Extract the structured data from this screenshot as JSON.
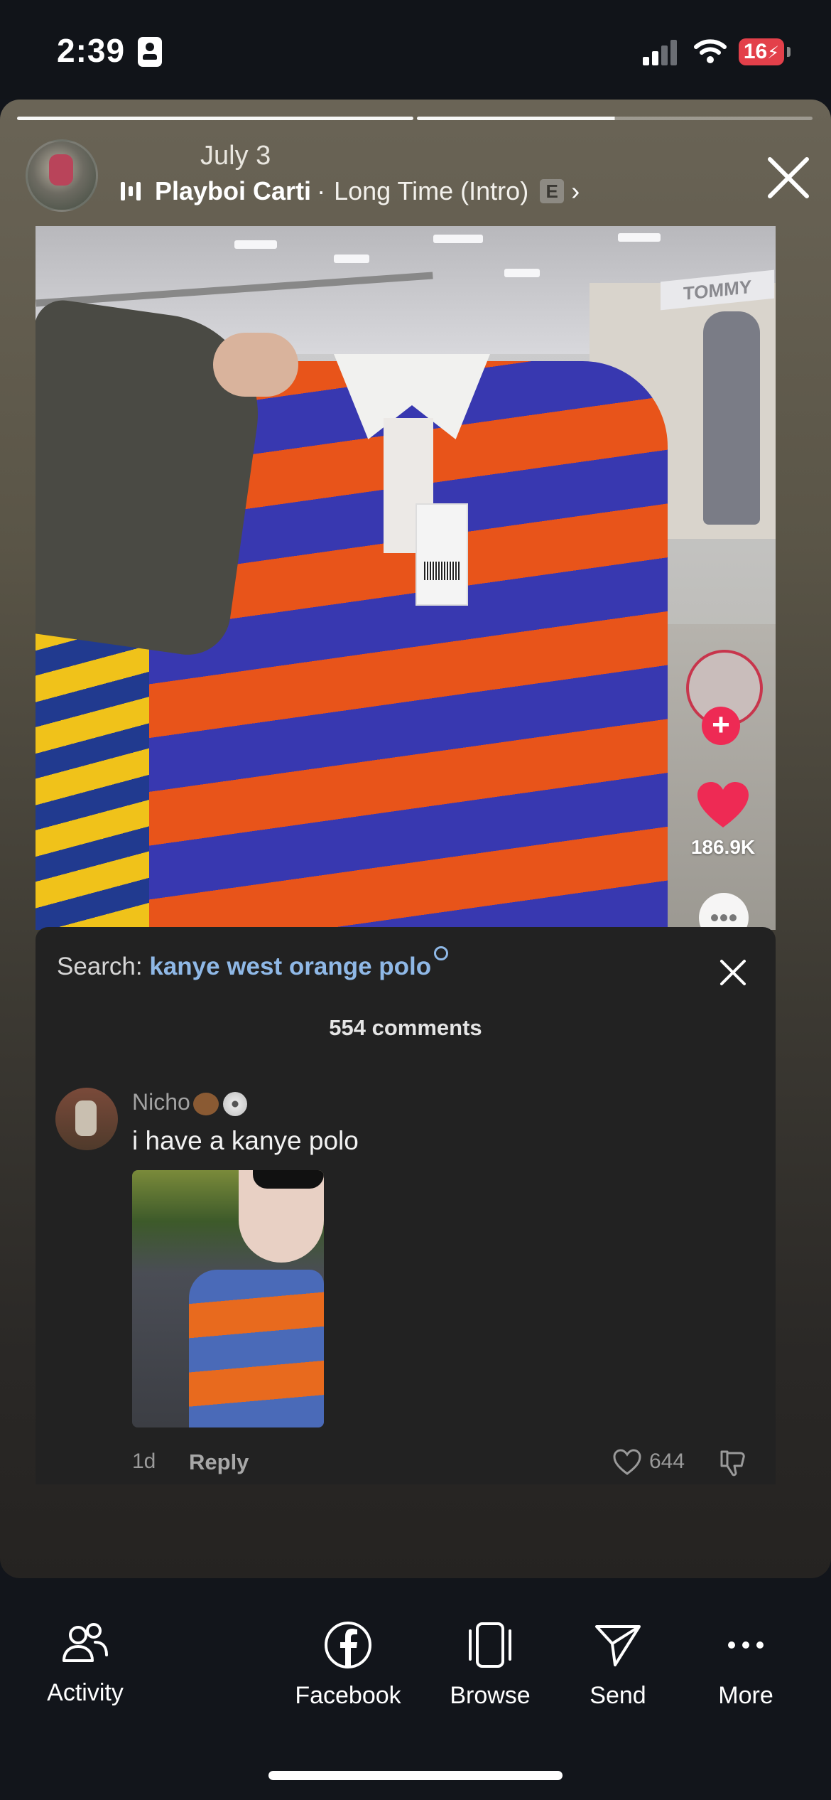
{
  "status_bar": {
    "time": "2:39",
    "battery": "16"
  },
  "story": {
    "date": "July 3",
    "music": {
      "artist": "Playboi Carti",
      "separator": "·",
      "song": "Long Time (Intro)",
      "explicit_badge": "E"
    },
    "progress": {
      "segments": 2,
      "current_segment": 1,
      "current_fill": 0.5
    },
    "like_count": "186.9K"
  },
  "comments_panel": {
    "search_label": "Search:",
    "search_query": "kanye west orange polo",
    "comment_count": "554 comments",
    "comments": [
      {
        "username": "Nicho",
        "text": "i have a kanye polo",
        "time": "1d",
        "reply_label": "Reply",
        "likes": "644"
      }
    ]
  },
  "bottom_nav": [
    {
      "label": "Activity",
      "icon": "people-icon"
    },
    {
      "label": "Facebook",
      "icon": "facebook-icon"
    },
    {
      "label": "Browse",
      "icon": "browse-icon"
    },
    {
      "label": "Send",
      "icon": "send-icon"
    },
    {
      "label": "More",
      "icon": "more-icon"
    }
  ],
  "colors": {
    "accent_pink": "#ee2a54",
    "search_blue": "#8fb8e6",
    "battery_red": "#e3404a"
  }
}
